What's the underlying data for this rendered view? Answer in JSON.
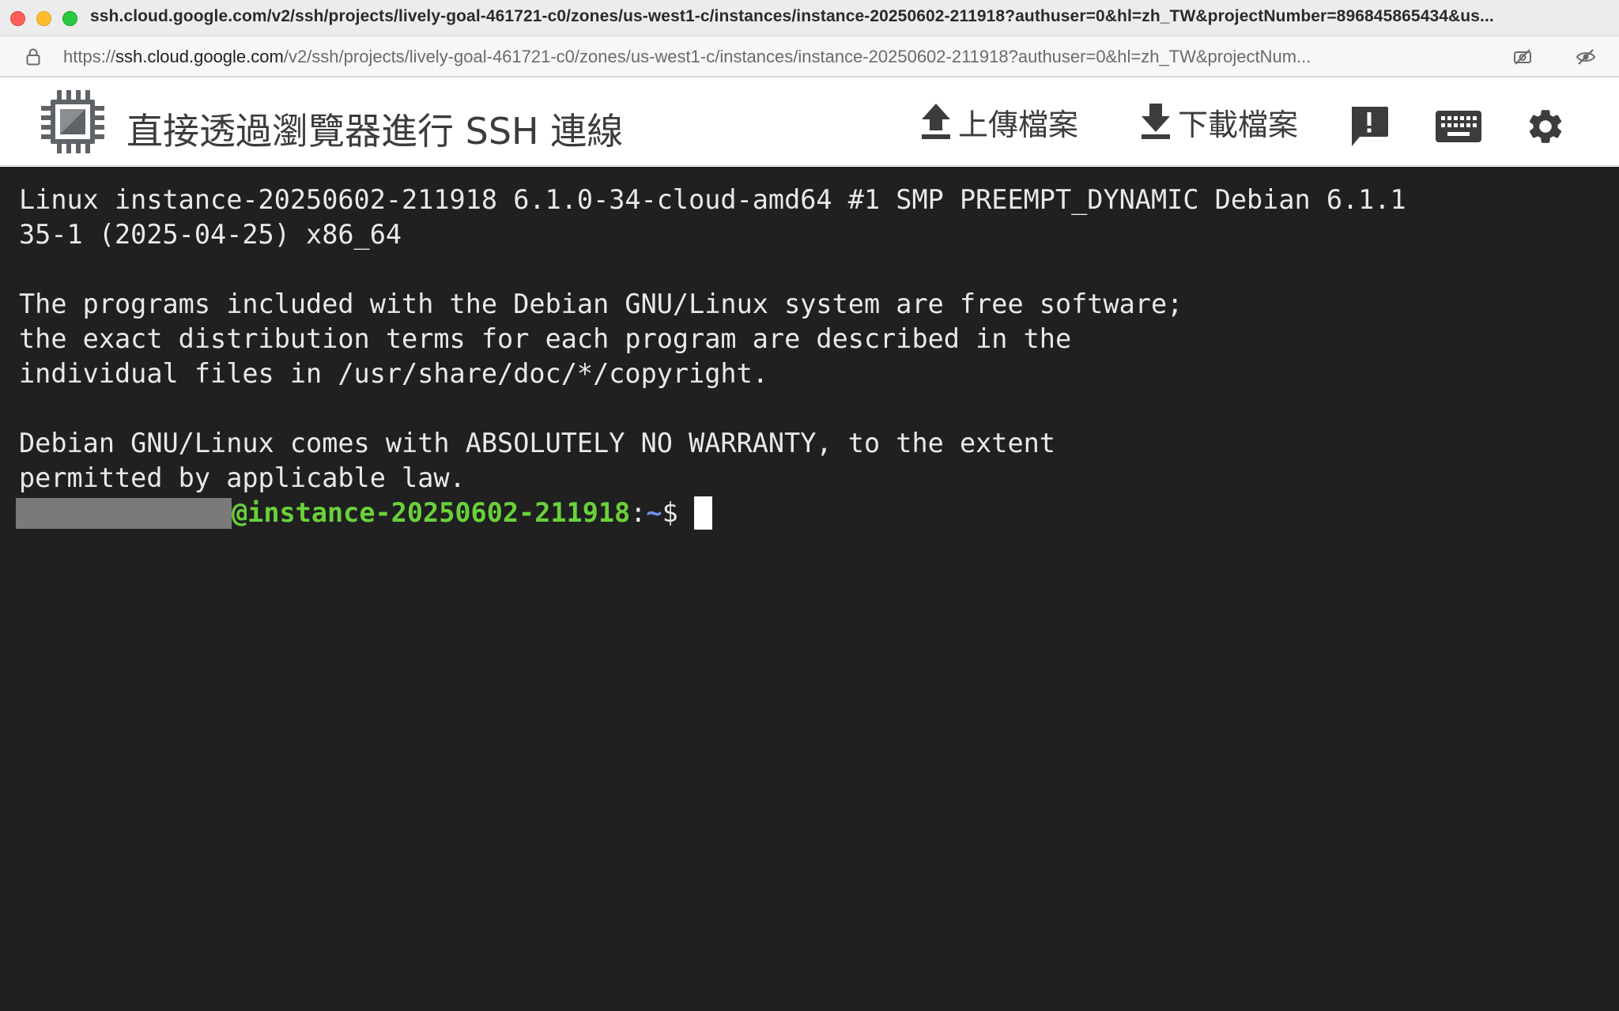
{
  "window": {
    "title": "ssh.cloud.google.com/v2/ssh/projects/lively-goal-461721-c0/zones/us-west1-c/instances/instance-20250602-211918?authuser=0&hl=zh_TW&projectNumber=896845865434&us..."
  },
  "urlbar": {
    "scheme": "https://",
    "host": "ssh.cloud.google.com",
    "path": "/v2/ssh/projects/lively-goal-461721-c0/zones/us-west1-c/instances/instance-20250602-211918?authuser=0&hl=zh_TW&projectNum..."
  },
  "header": {
    "title": "直接透過瀏覽器進行 SSH 連線",
    "upload_label": "上傳檔案",
    "download_label": "下載檔案"
  },
  "terminal": {
    "lines": [
      "Linux instance-20250602-211918 6.1.0-34-cloud-amd64 #1 SMP PREEMPT_DYNAMIC Debian 6.1.1",
      "35-1 (2025-04-25) x86_64",
      "",
      "The programs included with the Debian GNU/Linux system are free software;",
      "the exact distribution terms for each program are described in the",
      "individual files in /usr/share/doc/*/copyright.",
      "",
      "Debian GNU/Linux comes with ABSOLUTELY NO WARRANTY, to the extent",
      "permitted by applicable law."
    ],
    "prompt": {
      "host": "@instance-20250602-211918",
      "colon": ":",
      "path": "~",
      "symbol": "$"
    }
  },
  "colors": {
    "terminal_bg": "#202020",
    "terminal_fg": "#e9e9e9",
    "prompt_host": "#6ad13a",
    "prompt_path": "#6f8fe8",
    "header_icon": "#3c3c3c"
  }
}
